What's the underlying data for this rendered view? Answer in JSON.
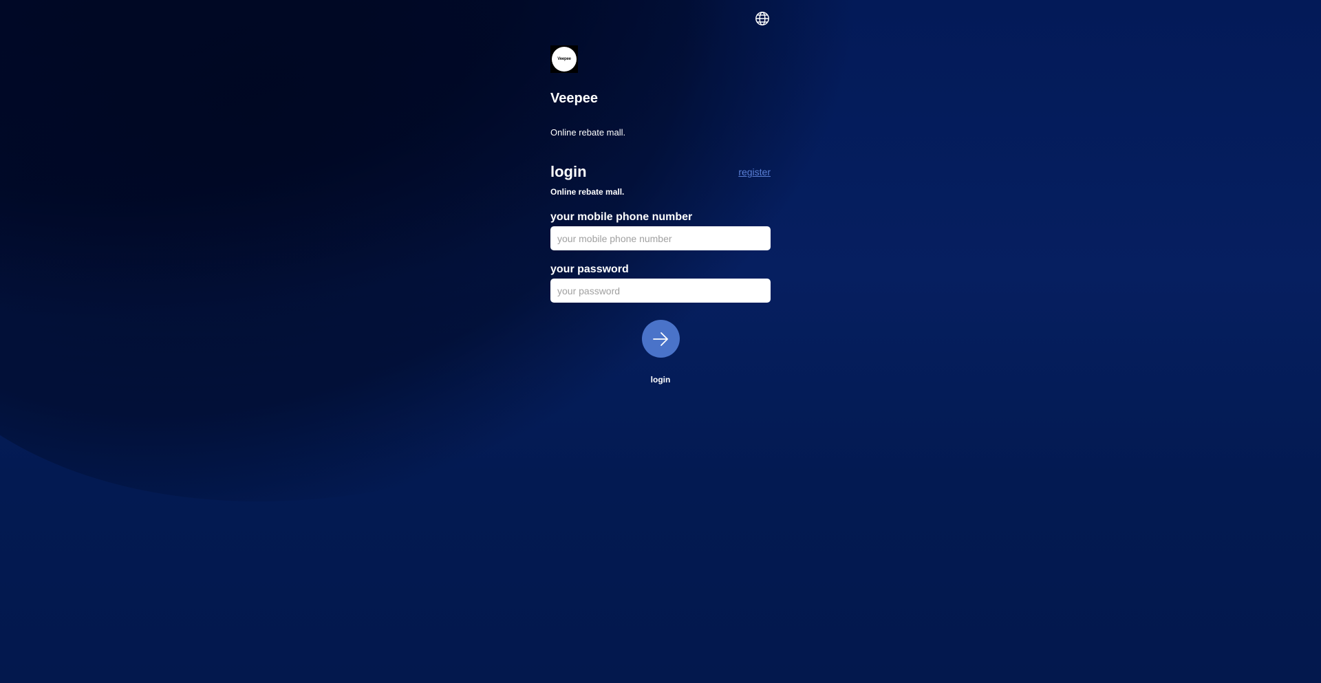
{
  "brand": {
    "logo_text": "Veepee",
    "name": "Veepee",
    "tagline": "Online rebate mall."
  },
  "login": {
    "title": "login",
    "register_link": "register",
    "subtitle": "Online rebate mall.",
    "phone": {
      "label": "your mobile phone number",
      "placeholder": "your mobile phone number",
      "value": ""
    },
    "password": {
      "label": "your password",
      "placeholder": "your password",
      "value": ""
    },
    "submit_label": "login"
  },
  "icons": {
    "language": "globe-icon",
    "submit": "arrow-right-icon"
  },
  "colors": {
    "background": "#041a4f",
    "link": "#5a7fd6",
    "submit_button": "#4a73c9",
    "input_background": "#ffffff"
  }
}
